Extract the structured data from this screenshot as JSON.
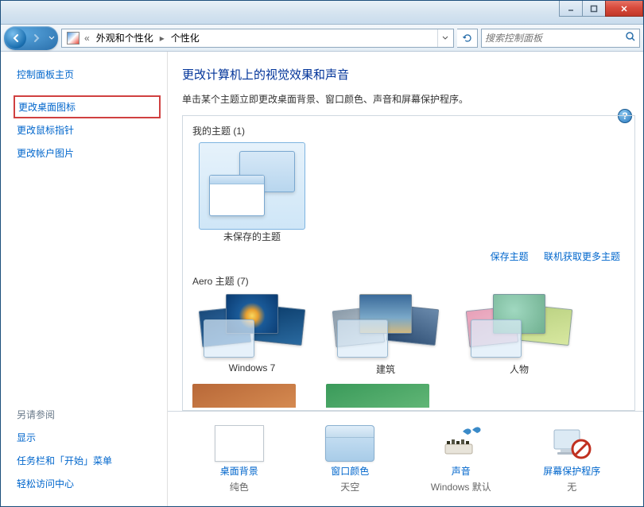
{
  "titlebar": {},
  "nav": {
    "crumb_root_sep": "«",
    "crumb1": "外观和个性化",
    "crumb2": "个性化",
    "search_placeholder": "搜索控制面板"
  },
  "sidebar": {
    "home": "控制面板主页",
    "links": [
      "更改桌面图标",
      "更改鼠标指针",
      "更改帐户图片"
    ],
    "see_also_heading": "另请参阅",
    "see_also": [
      "显示",
      "任务栏和「开始」菜单",
      "轻松访问中心"
    ]
  },
  "main": {
    "title": "更改计算机上的视觉效果和声音",
    "subtitle": "单击某个主题立即更改桌面背景、窗口颜色、声音和屏幕保护程序。",
    "sections": {
      "my_themes_label": "我的主题 (1)",
      "my_themes": [
        {
          "name": "未保存的主题"
        }
      ],
      "save_theme": "保存主题",
      "get_more": "联机获取更多主题",
      "aero_label": "Aero 主题 (7)",
      "aero": [
        {
          "name": "Windows 7"
        },
        {
          "name": "建筑"
        },
        {
          "name": "人物"
        }
      ]
    }
  },
  "bottom": {
    "items": [
      {
        "name": "桌面背景",
        "value": "纯色"
      },
      {
        "name": "窗口颜色",
        "value": "天空"
      },
      {
        "name": "声音",
        "value": "Windows 默认"
      },
      {
        "name": "屏幕保护程序",
        "value": "无"
      }
    ]
  }
}
